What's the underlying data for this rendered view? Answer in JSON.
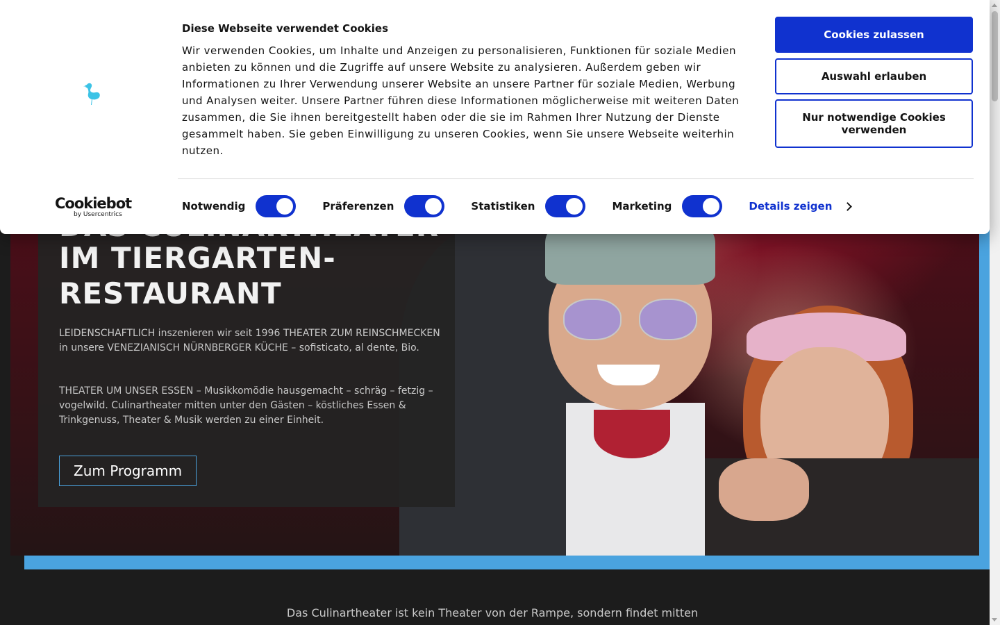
{
  "cookie_banner": {
    "title": "Diese Webseite verwendet Cookies",
    "body": "Wir verwenden Cookies, um Inhalte und Anzeigen zu personalisieren, Funktionen für soziale Medien anbieten zu können und die Zugriffe auf unsere Website zu analysieren. Außerdem geben wir Informationen zu Ihrer Verwendung unserer Website an unsere Partner für soziale Medien, Werbung und Analysen weiter. Unsere Partner führen diese Informationen möglicherweise mit weiteren Daten zusammen, die Sie ihnen bereitgestellt haben oder die sie im Rahmen Ihrer Nutzung der Dienste gesammelt haben. Sie geben Einwilligung zu unseren Cookies, wenn Sie unsere Webseite weiterhin nutzen.",
    "buttons": {
      "allow_all": "Cookies zulassen",
      "allow_selection": "Auswahl erlauben",
      "necessary_only": "Nur notwendige Cookies verwenden"
    },
    "toggles": [
      {
        "label": "Notwendig",
        "checked": true
      },
      {
        "label": "Präferenzen",
        "checked": true
      },
      {
        "label": "Statistiken",
        "checked": true
      },
      {
        "label": "Marketing",
        "checked": true
      }
    ],
    "details_link": "Details zeigen",
    "branding": {
      "name": "Cookiebot",
      "sub": "by Usercentrics"
    },
    "colors": {
      "accent": "#1032cf",
      "logo": "#3cc3e6"
    }
  },
  "hero": {
    "title_line_cut": "DAS CULINARTHEATER",
    "title_line2": "IM TIERGARTEN-",
    "title_line3": "RESTAURANT",
    "paragraph1": "LEIDENSCHAFTLICH inszenieren wir seit 1996 THEATER ZUM REINSCHMECKEN in unsere VENEZIANISCH NÜRNBERGER KÜCHE – sofisticato, al dente, Bio.",
    "paragraph2": "THEATER UM UNSER ESSEN – Musikkomödie hausgemacht – schräg – fetzig – vogelwild. Culinartheater mitten unter den Gästen – köstliches Essen & Trinkgenuss, Theater & Musik werden zu einer Einheit.",
    "cta": "Zum Programm",
    "colors": {
      "frame": "#4aa3df"
    }
  },
  "intro": {
    "text": "Das Culinartheater ist kein Theater von der Rampe, sondern findet mitten"
  }
}
